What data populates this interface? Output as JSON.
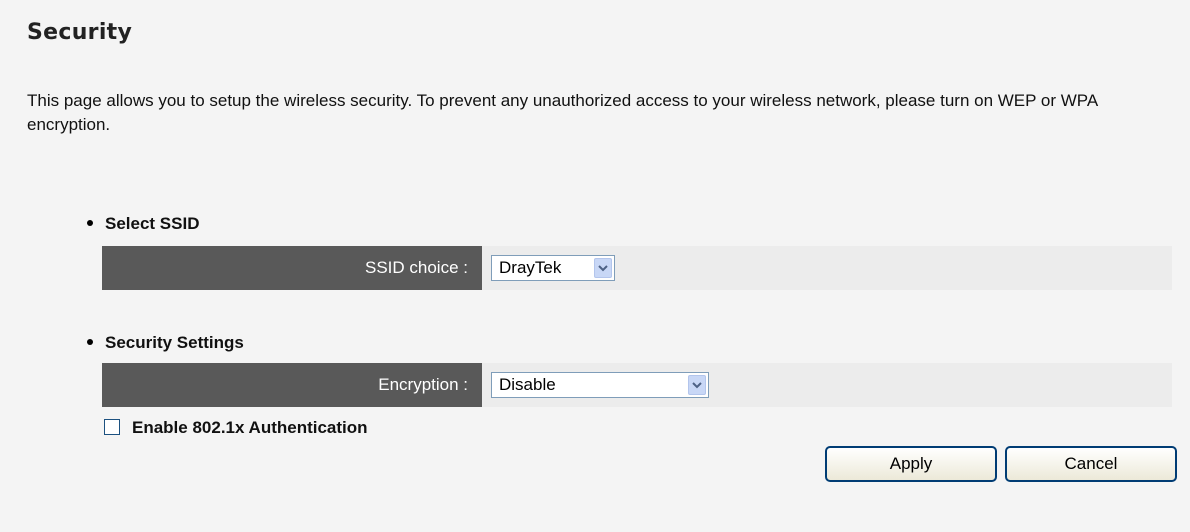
{
  "page": {
    "title": "Security",
    "description": "This page allows you to setup the wireless security. To prevent any unauthorized access to your wireless network, please turn on WEP or WPA encryption."
  },
  "ssid_section": {
    "heading": "Select SSID",
    "label": "SSID choice :",
    "selected": "DrayTek"
  },
  "security_section": {
    "heading": "Security Settings",
    "encryption_label": "Encryption :",
    "encryption_selected": "Disable",
    "auth_checkbox_label": "Enable 802.1x Authentication",
    "auth_checked": false
  },
  "buttons": {
    "apply": "Apply",
    "cancel": "Cancel"
  },
  "icons": {
    "dropdown_arrow": "chevron-down-icon",
    "bullet": "bullet-icon"
  },
  "colors": {
    "label_bg": "#595959",
    "dropdown_button": "#c8d7f6",
    "button_border": "#003c74"
  }
}
